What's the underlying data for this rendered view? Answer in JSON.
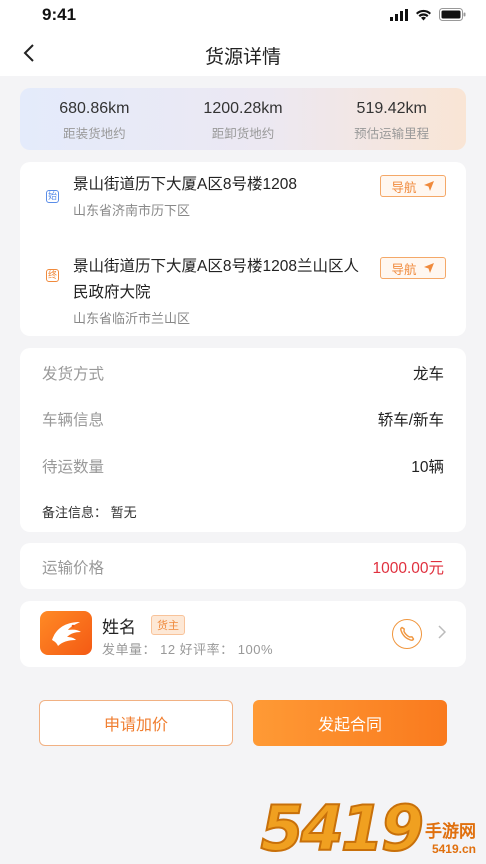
{
  "status_bar": {
    "time": "9:41"
  },
  "header": {
    "title": "货源详情"
  },
  "stats": [
    {
      "value": "680.86km",
      "label": "距装货地约"
    },
    {
      "value": "1200.28km",
      "label": "距卸货地约"
    },
    {
      "value": "519.42km",
      "label": "预估运输里程"
    }
  ],
  "route": {
    "start": {
      "tag": "始",
      "address": "景山街道历下大厦A区8号楼1208",
      "region": "山东省济南市历下区",
      "nav_label": "导航"
    },
    "end": {
      "tag": "终",
      "address": "景山街道历下大厦A区8号楼1208兰山区人民政府大院",
      "region": "山东省临沂市兰山区",
      "nav_label": "导航"
    }
  },
  "details": {
    "rows": [
      {
        "label": "发货方式",
        "value": "龙车"
      },
      {
        "label": "车辆信息",
        "value": "轿车/新车"
      },
      {
        "label": "待运数量",
        "value": "10辆"
      }
    ],
    "remark": "备注信息：  暂无"
  },
  "price": {
    "label": "运输价格",
    "value": "1000.00元",
    "color": "#e0303e"
  },
  "user": {
    "name": "姓名",
    "badge": "货主",
    "stats": "发单量： 12    好评率： 100%"
  },
  "actions": {
    "raise_price": "申请加价",
    "start_contract": "发起合同"
  },
  "watermark": {
    "number": "5419",
    "cn": "手游网",
    "site": "5419.cn"
  },
  "colors": {
    "accent": "#f97a1e",
    "price": "#e0303e"
  }
}
